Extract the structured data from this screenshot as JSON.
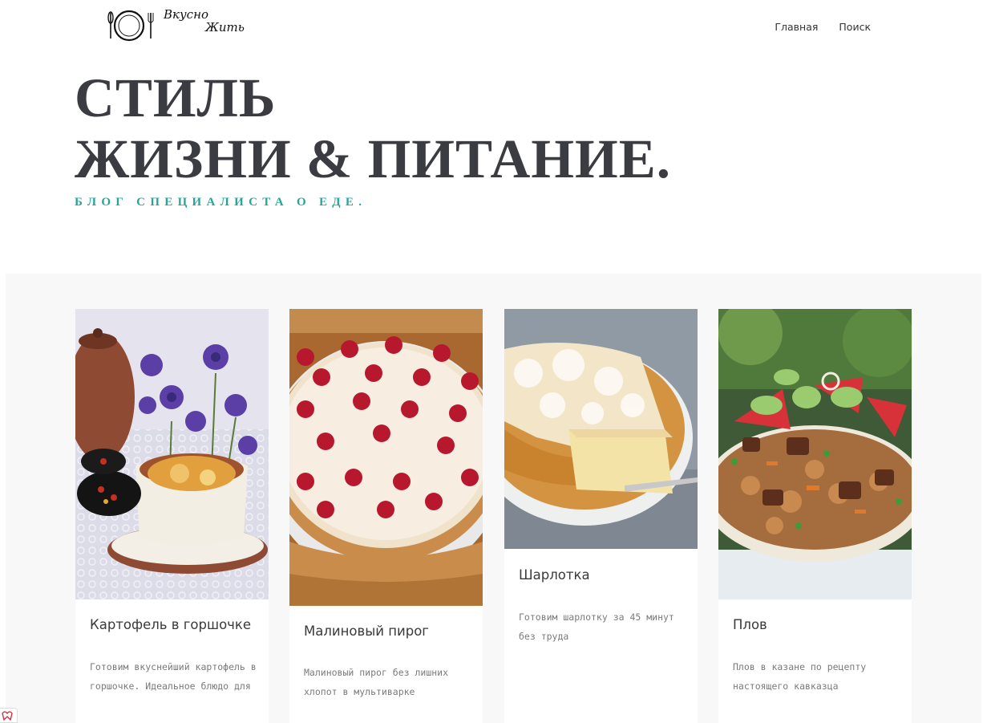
{
  "header": {
    "logo_line1": "Вкусно",
    "logo_line2": "Жить",
    "nav": [
      "Главная",
      "Поиск"
    ]
  },
  "hero": {
    "title_line1": "СТИЛЬ",
    "title_line2": "ЖИЗНИ & ПИТАНИЕ.",
    "subtitle": "БЛОГ СПЕЦИАЛИСТА О ЕДЕ."
  },
  "posts": [
    {
      "title": "Картофель в горшочке",
      "excerpt": "Готовим вкуснейший картофель в горшочке. Идеальное блюдо для"
    },
    {
      "title": "Малиновый пирог",
      "excerpt": "Малиновый пирог без лишних хлопот в мультиварке"
    },
    {
      "title": "Шарлотка",
      "excerpt": "Готовим шарлотку за 45 минут без труда"
    },
    {
      "title": "Плов",
      "excerpt": "Плов в казане по рецепту настоящего кавказца"
    }
  ],
  "colors": {
    "accent": "#27a49a",
    "heading": "#3b3c42",
    "section_bg": "#f8f8f8"
  }
}
